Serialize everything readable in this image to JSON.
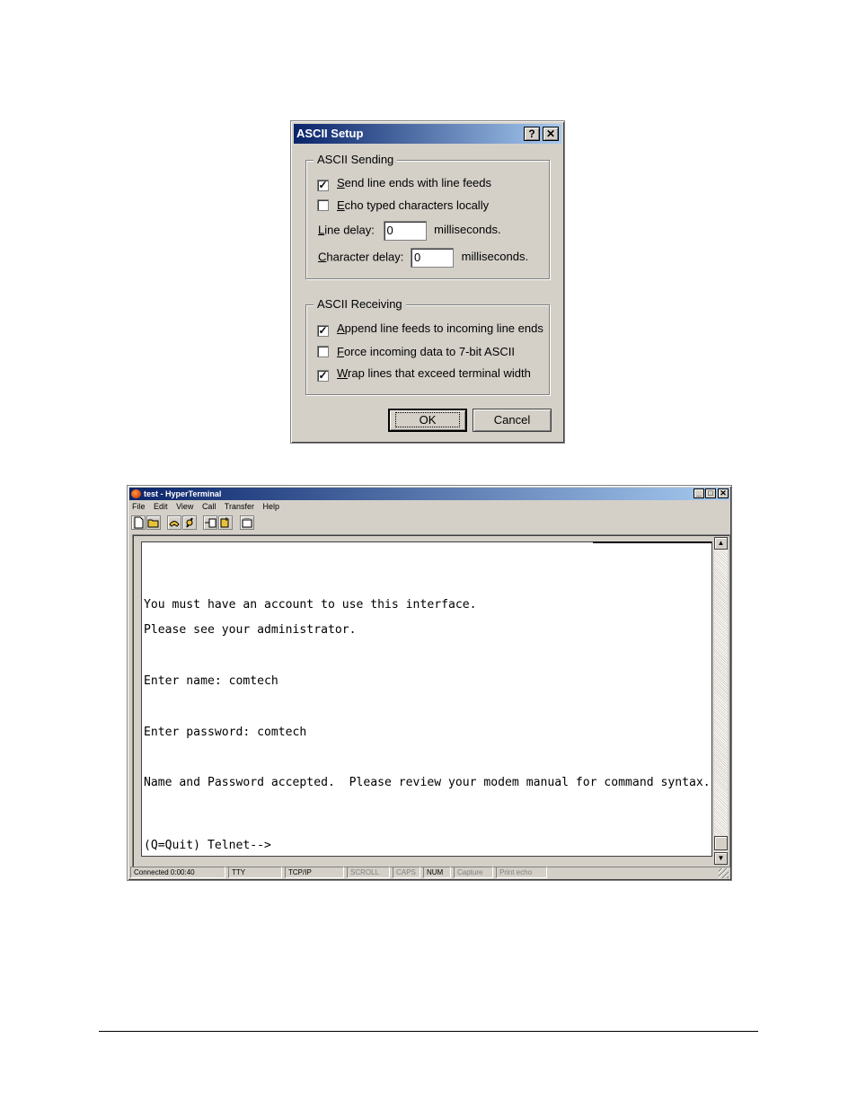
{
  "ascii_setup": {
    "title": "ASCII Setup",
    "help_btn": "?",
    "close_btn": "✕",
    "sending": {
      "legend": "ASCII Sending",
      "send_line_ends": {
        "mnemonic": "S",
        "rest": "end line ends with line feeds",
        "checked": true
      },
      "echo_typed": {
        "mnemonic": "E",
        "rest": "cho typed characters locally",
        "checked": false
      },
      "line_delay": {
        "mnemonic": "L",
        "rest": "ine delay:",
        "value": "0",
        "unit": "milliseconds."
      },
      "char_delay": {
        "mnemonic": "C",
        "rest": "haracter delay:",
        "value": "0",
        "unit": "milliseconds."
      }
    },
    "receiving": {
      "legend": "ASCII Receiving",
      "append_line_feeds": {
        "mnemonic": "A",
        "rest": "ppend line feeds to incoming line ends",
        "checked": true
      },
      "force_7bit": {
        "mnemonic": "F",
        "rest": "orce incoming data to 7-bit ASCII",
        "checked": false
      },
      "wrap_lines": {
        "mnemonic": "W",
        "rest": "rap lines that exceed terminal width",
        "checked": true
      }
    },
    "ok": "OK",
    "cancel": "Cancel"
  },
  "hyperterminal": {
    "title": "test - HyperTerminal",
    "window_buttons": {
      "minimize": "_",
      "maximize": "□",
      "close": "✕"
    },
    "menu": [
      "File",
      "Edit",
      "View",
      "Call",
      "Transfer",
      "Help"
    ],
    "toolbar": [
      "new-icon",
      "open-icon",
      "connect-icon",
      "disconnect-icon",
      "send-icon",
      "receive-icon",
      "properties-icon"
    ],
    "terminal_lines": [
      "You must have an account to use this interface.",
      "Please see your administrator.",
      "Enter name: comtech",
      "Enter password: comtech",
      "Name and Password accepted.  Please review your modem manual for command syntax.",
      "(Q=Quit) Telnet-->"
    ],
    "status": {
      "connected": "Connected 0:00:40",
      "emulation": "TTY",
      "protocol": "TCP/IP",
      "scroll": "SCROLL",
      "caps": "CAPS",
      "num": "NUM",
      "capture": "Capture",
      "print_echo": "Print echo"
    }
  }
}
